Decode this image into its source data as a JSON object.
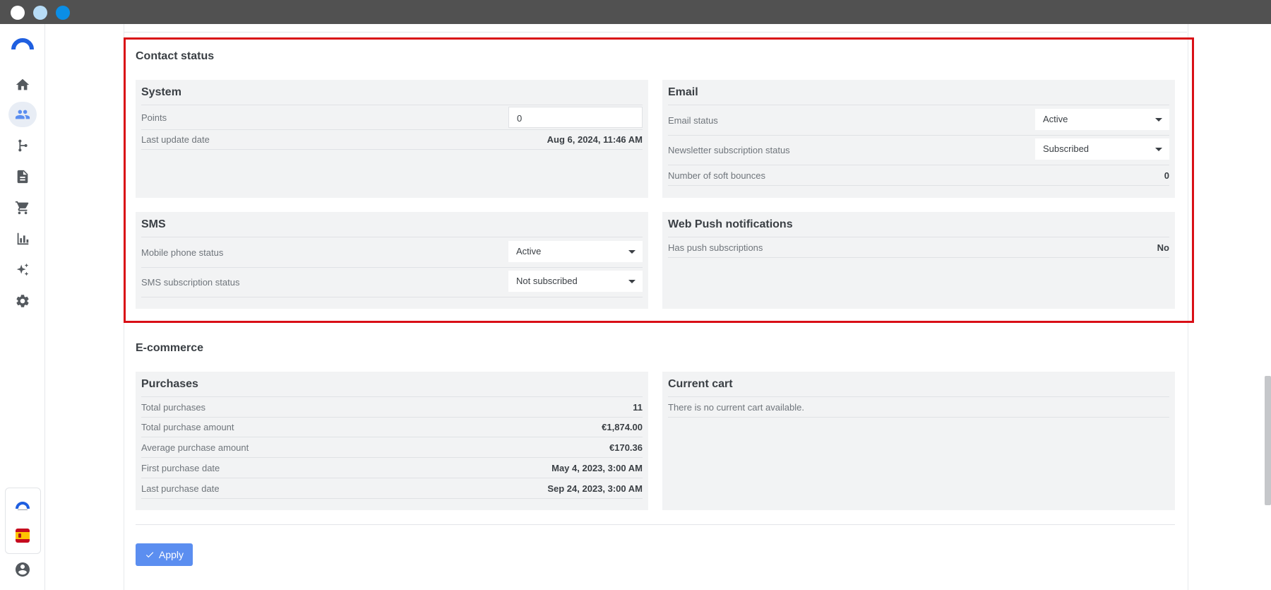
{
  "contact_status": {
    "title": "Contact status",
    "system": {
      "title": "System",
      "points_label": "Points",
      "points_value": "0",
      "last_update_label": "Last update date",
      "last_update_value": "Aug 6, 2024, 11:46 AM"
    },
    "email": {
      "title": "Email",
      "email_status_label": "Email status",
      "email_status_value": "Active",
      "newsletter_label": "Newsletter subscription status",
      "newsletter_value": "Subscribed",
      "soft_bounces_label": "Number of soft bounces",
      "soft_bounces_value": "0"
    },
    "sms": {
      "title": "SMS",
      "mobile_status_label": "Mobile phone status",
      "mobile_status_value": "Active",
      "sms_subscription_label": "SMS subscription status",
      "sms_subscription_value": "Not subscribed"
    },
    "web_push": {
      "title": "Web Push notifications",
      "has_push_label": "Has push subscriptions",
      "has_push_value": "No"
    }
  },
  "ecommerce": {
    "title": "E-commerce",
    "purchases": {
      "title": "Purchases",
      "rows": [
        {
          "label": "Total purchases",
          "value": "11"
        },
        {
          "label": "Total purchase amount",
          "value": "€1,874.00"
        },
        {
          "label": "Average purchase amount",
          "value": "€170.36"
        },
        {
          "label": "First purchase date",
          "value": "May 4, 2023, 3:00 AM"
        },
        {
          "label": "Last purchase date",
          "value": "Sep 24, 2023, 3:00 AM"
        }
      ]
    },
    "current_cart": {
      "title": "Current cart",
      "empty_text": "There is no current cart available."
    }
  },
  "apply_label": "Apply",
  "icons": {
    "nav": [
      "home-icon",
      "contacts-icon",
      "automation-icon",
      "document-icon",
      "cart-icon",
      "reports-icon",
      "ai-sparkles-icon",
      "settings-icon"
    ],
    "bottom": [
      "brand-icon",
      "spain-flag-icon",
      "account-icon"
    ]
  },
  "colors": {
    "accent": "#5b8ef0",
    "highlight": "#d90f16",
    "active_nav": "#5b8ef0"
  }
}
